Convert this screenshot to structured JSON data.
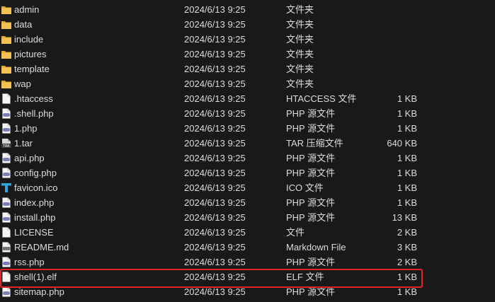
{
  "colors": {
    "background": "#191919",
    "text": "#dcdcdc",
    "folder": "#f2c255",
    "highlight": "#e02424"
  },
  "files": [
    {
      "name": "admin",
      "date": "2024/6/13 9:25",
      "type": "文件夹",
      "size": "",
      "icon": "folder-icon"
    },
    {
      "name": "data",
      "date": "2024/6/13 9:25",
      "type": "文件夹",
      "size": "",
      "icon": "folder-icon"
    },
    {
      "name": "include",
      "date": "2024/6/13 9:25",
      "type": "文件夹",
      "size": "",
      "icon": "folder-icon"
    },
    {
      "name": "pictures",
      "date": "2024/6/13 9:25",
      "type": "文件夹",
      "size": "",
      "icon": "folder-icon"
    },
    {
      "name": "template",
      "date": "2024/6/13 9:25",
      "type": "文件夹",
      "size": "",
      "icon": "folder-icon"
    },
    {
      "name": "wap",
      "date": "2024/6/13 9:25",
      "type": "文件夹",
      "size": "",
      "icon": "folder-icon"
    },
    {
      "name": ".htaccess",
      "date": "2024/6/13 9:25",
      "type": "HTACCESS 文件",
      "size": "1 KB",
      "icon": "file-icon"
    },
    {
      "name": ".shell.php",
      "date": "2024/6/13 9:25",
      "type": "PHP 源文件",
      "size": "1 KB",
      "icon": "php-file-icon"
    },
    {
      "name": "1.php",
      "date": "2024/6/13 9:25",
      "type": "PHP 源文件",
      "size": "1 KB",
      "icon": "php-file-icon"
    },
    {
      "name": "1.tar",
      "date": "2024/6/13 9:25",
      "type": "TAR 压缩文件",
      "size": "640 KB",
      "icon": "tar-archive-icon"
    },
    {
      "name": "api.php",
      "date": "2024/6/13 9:25",
      "type": "PHP 源文件",
      "size": "1 KB",
      "icon": "php-file-icon"
    },
    {
      "name": "config.php",
      "date": "2024/6/13 9:25",
      "type": "PHP 源文件",
      "size": "1 KB",
      "icon": "php-file-icon"
    },
    {
      "name": "favicon.ico",
      "date": "2024/6/13 9:25",
      "type": "ICO 文件",
      "size": "1 KB",
      "icon": "ico-file-icon"
    },
    {
      "name": "index.php",
      "date": "2024/6/13 9:25",
      "type": "PHP 源文件",
      "size": "1 KB",
      "icon": "php-file-icon"
    },
    {
      "name": "install.php",
      "date": "2024/6/13 9:25",
      "type": "PHP 源文件",
      "size": "13 KB",
      "icon": "php-file-icon"
    },
    {
      "name": "LICENSE",
      "date": "2024/6/13 9:25",
      "type": "文件",
      "size": "2 KB",
      "icon": "file-icon"
    },
    {
      "name": "README.md",
      "date": "2024/6/13 9:25",
      "type": "Markdown File",
      "size": "3 KB",
      "icon": "markdown-file-icon"
    },
    {
      "name": "rss.php",
      "date": "2024/6/13 9:25",
      "type": "PHP 源文件",
      "size": "2 KB",
      "icon": "php-file-icon"
    },
    {
      "name": "shell(1).elf",
      "date": "2024/6/13 9:25",
      "type": "ELF 文件",
      "size": "1 KB",
      "icon": "file-icon"
    },
    {
      "name": "sitemap.php",
      "date": "2024/6/13 9:25",
      "type": "PHP 源文件",
      "size": "1 KB",
      "icon": "php-file-icon"
    }
  ]
}
